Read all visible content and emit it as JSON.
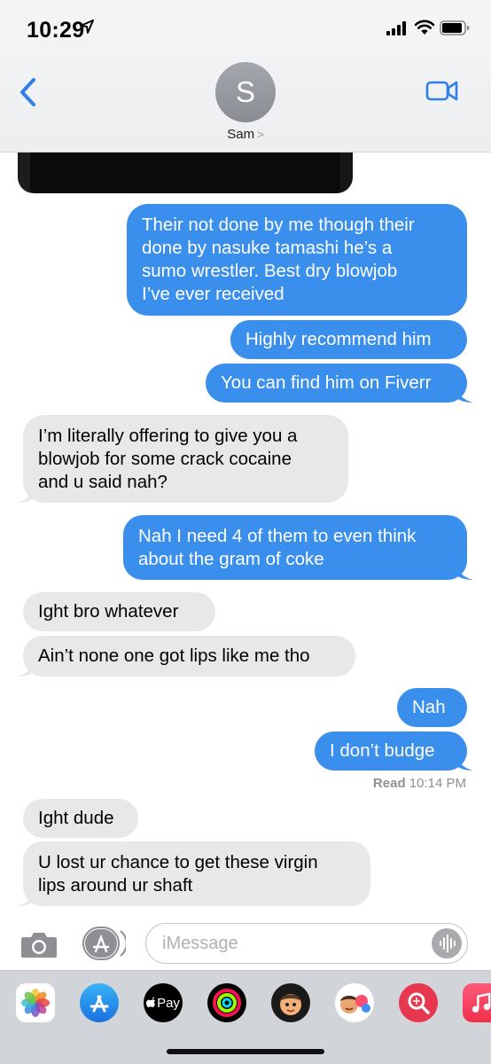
{
  "status_bar": {
    "time": "10:29"
  },
  "header": {
    "avatar_initial": "S",
    "contact_name": "Sam",
    "name_chevron": ">"
  },
  "messages": [
    {
      "side": "sent",
      "lines": [
        "Their not done by me though their",
        "done by nasuke tamashi he’s a",
        "sumo wrestler. Best dry blowjob",
        "I’ve ever received"
      ]
    },
    {
      "side": "sent",
      "lines": [
        "Highly recommend him"
      ]
    },
    {
      "side": "sent",
      "lines": [
        "You can find him on Fiverr"
      ]
    },
    {
      "side": "recv",
      "lines": [
        "I’m literally offering to give you a",
        "blowjob for some crack cocaine",
        "and u said nah?"
      ]
    },
    {
      "side": "sent",
      "lines": [
        "Nah I need 4 of them to even think",
        "about the gram of coke"
      ]
    },
    {
      "side": "recv",
      "lines": [
        "Ight bro whatever"
      ]
    },
    {
      "side": "recv",
      "lines": [
        "Ain’t none one got lips like me tho"
      ]
    },
    {
      "side": "sent",
      "lines": [
        "Nah"
      ]
    },
    {
      "side": "sent",
      "lines": [
        "I don’t budge"
      ]
    },
    {
      "side": "recv",
      "lines": [
        "Ight dude"
      ]
    },
    {
      "side": "recv",
      "lines": [
        "U lost ur chance to get these virgin",
        "lips around ur shaft"
      ]
    }
  ],
  "read_receipt": {
    "label": "Read",
    "time": "10:14 PM"
  },
  "input": {
    "placeholder": "iMessage",
    "value": ""
  },
  "app_drawer": {
    "apps": [
      {
        "name": "photos",
        "icon": "photos-icon"
      },
      {
        "name": "app-store",
        "icon": "app-store-icon"
      },
      {
        "name": "apple-pay",
        "icon": "apple-pay-icon",
        "label": "Pay"
      },
      {
        "name": "activity",
        "icon": "activity-rings-icon"
      },
      {
        "name": "animoji",
        "icon": "animoji-icon"
      },
      {
        "name": "memoji",
        "icon": "memoji-icon"
      },
      {
        "name": "image-search",
        "icon": "image-search-icon"
      },
      {
        "name": "music",
        "icon": "music-icon"
      }
    ]
  },
  "colors": {
    "sent_bubble": "#3a8fec",
    "received_bubble": "#e8e8ea",
    "accent": "#2f7fe6"
  }
}
